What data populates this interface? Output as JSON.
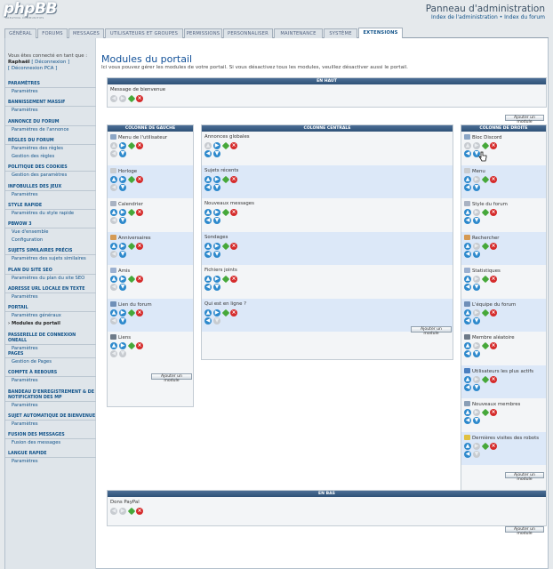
{
  "header": {
    "logo": "phpBB",
    "logo_sub": "CREATING COMMUNITIES",
    "title": "Panneau d'administration",
    "link_admin": "Index de l'administration",
    "sep": "•",
    "link_forum": "Index du forum"
  },
  "tabs": [
    "Général",
    "Forums",
    "Messages",
    "Utilisateurs et groupes",
    "Permissions",
    "Personnaliser",
    "Maintenance",
    "Système",
    "Extensions"
  ],
  "active_tab": "Extensions",
  "user": {
    "logged_as": "Vous êtes connecté en tant que :",
    "name": "Raphaël",
    "logout": "[ Déconnexion ]",
    "logout_pca": "[ Déconnexion PCA ]"
  },
  "sidebar": [
    {
      "head": "Paramètres",
      "items": [
        "Paramètres"
      ]
    },
    {
      "head": "Bannissement massif",
      "items": [
        "Paramètres"
      ]
    },
    {
      "head": "Annonce du forum",
      "items": [
        "Paramètres de l'annonce"
      ]
    },
    {
      "head": "Règles du forum",
      "items": [
        "Paramètres des règles",
        "Gestion des règles"
      ]
    },
    {
      "head": "Politique des cookies",
      "items": [
        "Gestion des paramètres"
      ]
    },
    {
      "head": "Infobulles des jeux",
      "items": [
        "Paramètres"
      ]
    },
    {
      "head": "Style rapide",
      "items": [
        "Paramètres du style rapide"
      ]
    },
    {
      "head": "PBWOW 3",
      "items": [
        "Vue d'ensemble",
        "Configuration"
      ]
    },
    {
      "head": "Sujets similaires précis",
      "items": [
        "Paramètres des sujets similaires"
      ]
    },
    {
      "head": "Plan du site SEO",
      "items": [
        "Paramètres du plan du site SEO"
      ]
    },
    {
      "head": "Adresse URL locale en texte",
      "items": [
        "Paramètres"
      ]
    },
    {
      "head": "Portail",
      "items": [
        "Paramètres généraux",
        "Modules du portail"
      ]
    },
    {
      "head": "Passerelle de connexion OneAll",
      "items": [
        "Paramètres"
      ]
    },
    {
      "head": "Pages",
      "items": [
        "Gestion de Pages"
      ]
    },
    {
      "head": "Compte à rebours",
      "items": [
        "Paramètres"
      ]
    },
    {
      "head": "Bandeau d'enregistrement & de notification des MP",
      "items": [
        "Paramètres"
      ]
    },
    {
      "head": "Sujet automatique de bienvenue",
      "items": [
        "Paramètres"
      ]
    },
    {
      "head": "Fusion des messages",
      "items": [
        "Fusion des messages"
      ]
    },
    {
      "head": "Langue rapide",
      "items": [
        "Paramètres"
      ]
    }
  ],
  "current_item": "Modules du portail",
  "page": {
    "title": "Modules du portail",
    "description": "Ici vous pouvez gérer les modules de votre portail. Si vous désactivez tous les modules, veuillez désactiver aussi le portail.",
    "add_label": "Ajouter un module"
  },
  "blocks": {
    "top": {
      "title": "En haut",
      "modules": [
        "Message de bienvenue"
      ]
    },
    "left": {
      "title": "Colonne de gauche",
      "modules": [
        "Menu de l'utilisateur",
        "Horloge",
        "Calendrier",
        "Anniversaires",
        "Amis",
        "Lien du forum",
        "Liens"
      ]
    },
    "center": {
      "title": "Colonne centrale",
      "modules": [
        "Annonces globales",
        "Sujets récents",
        "Nouveaux messages",
        "Sondages",
        "Fichiers joints",
        "Qui est en ligne ?"
      ]
    },
    "right": {
      "title": "Colonne de droite",
      "modules": [
        "Bloc Discord",
        "Menu",
        "Style du forum",
        "Rechercher",
        "Statistiques",
        "L'équipe du forum",
        "Membre aléatoire",
        "Utilisateurs les plus actifs",
        "Nouveaux membres",
        "Dernières visites des robots"
      ]
    },
    "bottom": {
      "title": "En bas",
      "modules": [
        "Dons PayPal"
      ]
    }
  },
  "colors": {
    "accent": "#105289",
    "block_head": "#3e6088",
    "alt_row": "#dce8f8",
    "up_down": "#2d89cc",
    "config": "#46a83a",
    "delete": "#d52b2b",
    "disabled": "#c7cbd0"
  },
  "icons": {
    "up": "up-arrow-icon",
    "down": "down-arrow-icon",
    "left": "left-arrow-icon",
    "right": "right-arrow-icon",
    "configure": "gear-icon",
    "delete": "delete-icon"
  }
}
